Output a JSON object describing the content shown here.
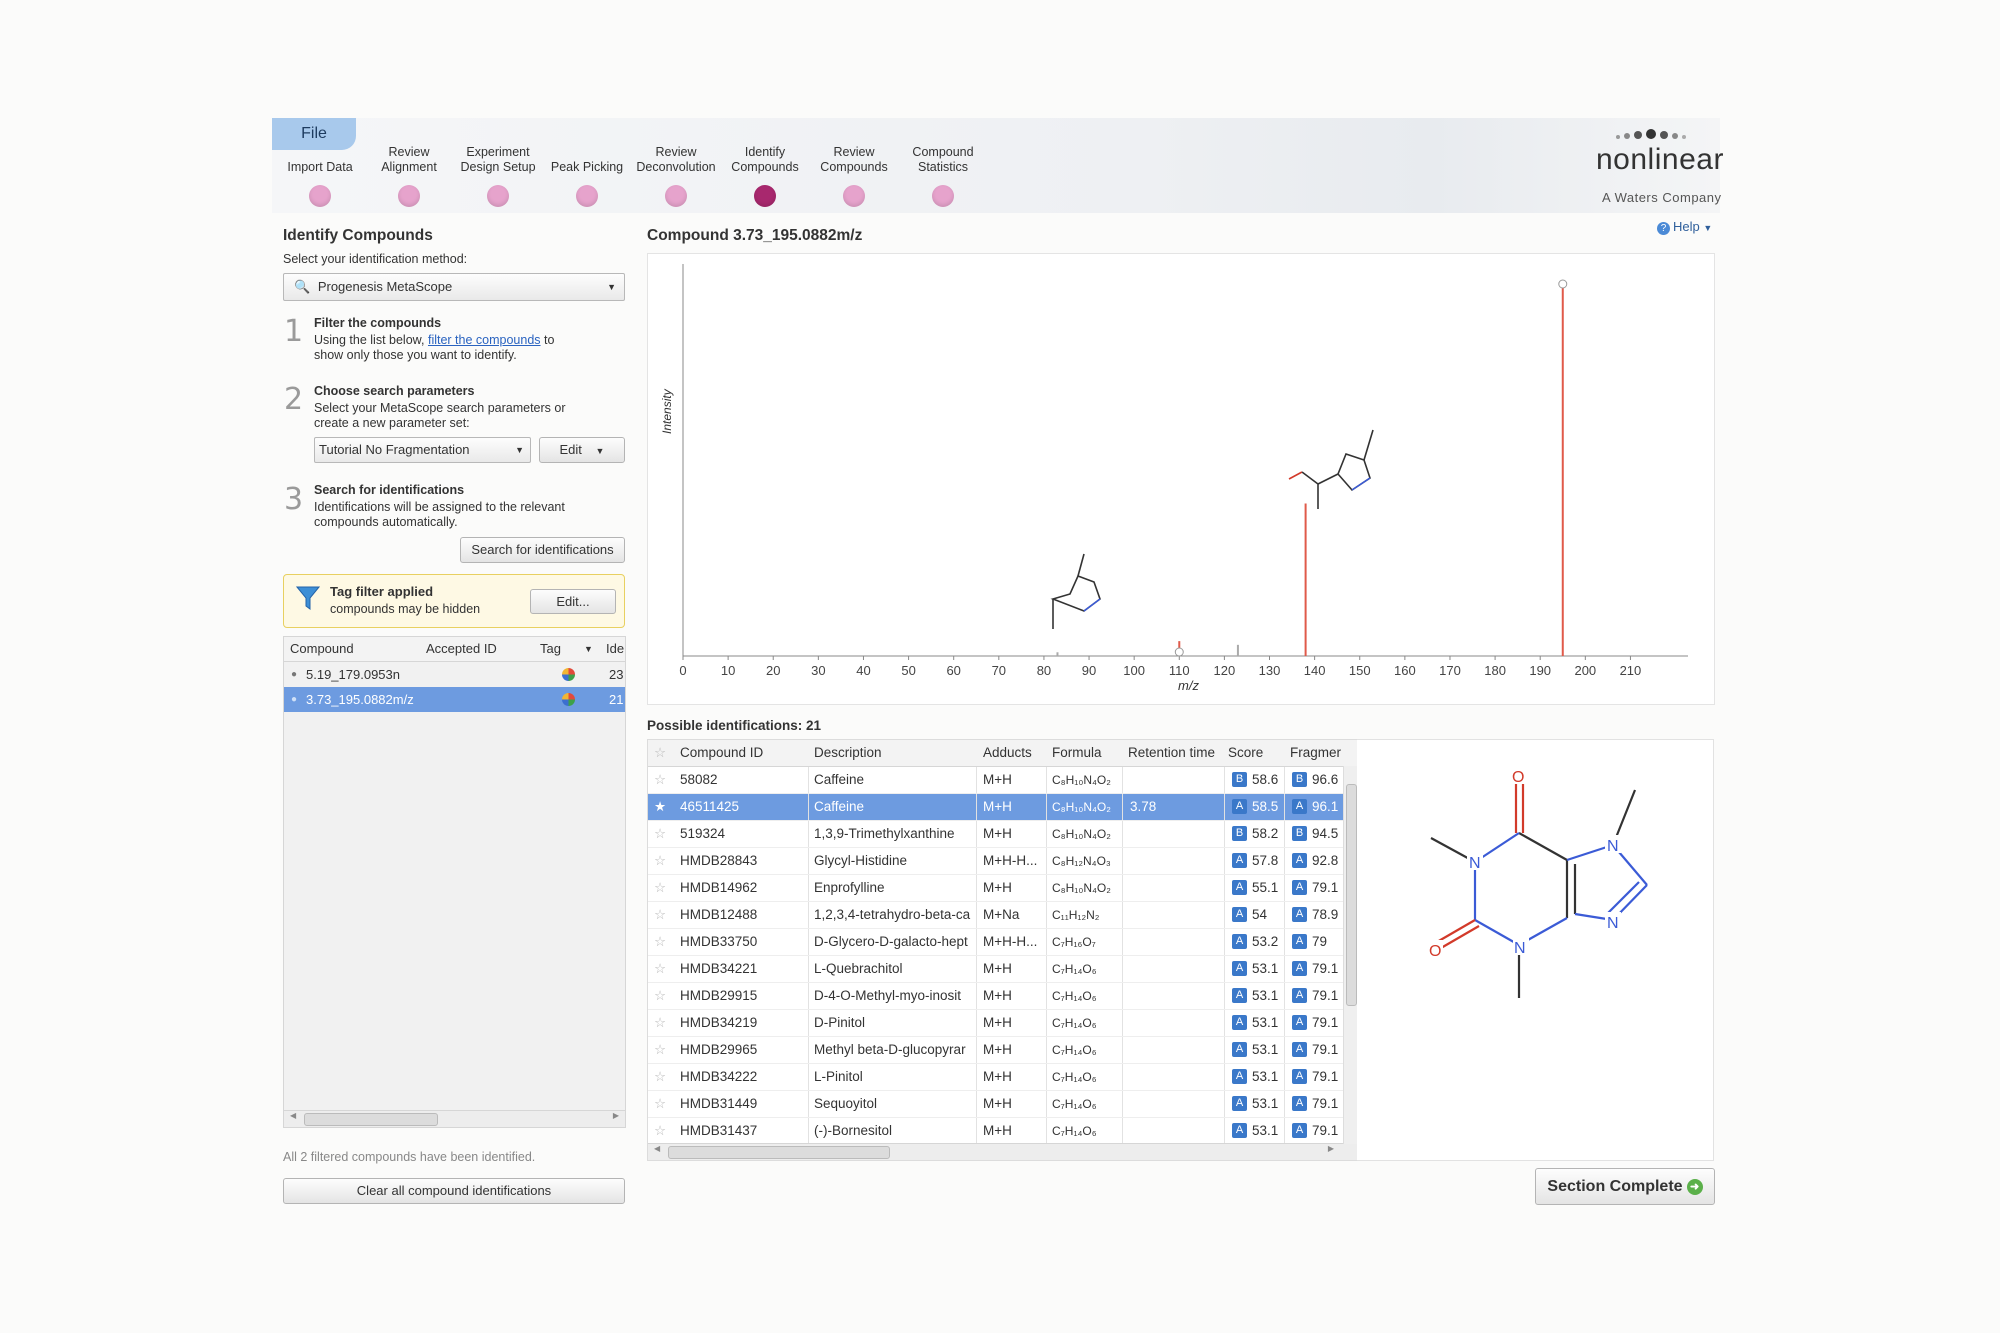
{
  "nav": {
    "file": "File",
    "steps": [
      {
        "l1": "",
        "l2": "Import Data"
      },
      {
        "l1": "Review",
        "l2": "Alignment"
      },
      {
        "l1": "Experiment",
        "l2": "Design Setup"
      },
      {
        "l1": "",
        "l2": "Peak Picking"
      },
      {
        "l1": "Review",
        "l2": "Deconvolution"
      },
      {
        "l1": "Identify",
        "l2": "Compounds"
      },
      {
        "l1": "Review",
        "l2": "Compounds"
      },
      {
        "l1": "Compound",
        "l2": "Statistics"
      }
    ],
    "active_step": 5
  },
  "brand": {
    "name": "nonlinear",
    "sub": "A Waters Company",
    "help": "Help"
  },
  "left": {
    "title": "Identify Compounds",
    "method_label": "Select your identification method:",
    "method_value": "Progenesis MetaScope",
    "step1": {
      "num": "1",
      "title": "Filter the compounds",
      "text_a": "Using the list below,",
      "link": "filter the compounds",
      "text_b": "to",
      "text_c": "show only those you want to identify."
    },
    "step2": {
      "num": "2",
      "title": "Choose search parameters",
      "text_a": "Select your MetaScope search parameters or",
      "text_b": "create a new parameter set:",
      "param_value": "Tutorial No Fragmentation",
      "edit": "Edit"
    },
    "step3": {
      "num": "3",
      "title": "Search for identifications",
      "text_a": "Identifications will be assigned to the relevant",
      "text_b": "compounds automatically.",
      "button": "Search for identifications"
    },
    "tag_filter": {
      "title": "Tag filter applied",
      "sub": "compounds may be hidden",
      "edit": "Edit..."
    },
    "table": {
      "headers": [
        "Compound",
        "Accepted ID",
        "Tag",
        "Ide"
      ],
      "rows": [
        {
          "compound": "5.19_179.0953n",
          "ide": "23"
        },
        {
          "compound": "3.73_195.0882m/z",
          "ide": "21"
        }
      ],
      "selected": 1
    },
    "status": "All 2 filtered compounds have been identified.",
    "clear_button": "Clear all compound identifications"
  },
  "chart_title": "Compound 3.73_195.0882m/z",
  "chart_data": {
    "type": "bar",
    "xlabel": "m/z",
    "ylabel": "Intensity",
    "xlim": [
      0,
      215
    ],
    "x_ticks": [
      0,
      10,
      20,
      30,
      40,
      50,
      60,
      70,
      80,
      90,
      100,
      110,
      120,
      130,
      140,
      150,
      160,
      170,
      180,
      190,
      200,
      210
    ],
    "ylim": [
      0,
      100
    ],
    "series": [
      {
        "color": "#e05a4a",
        "bars": [
          {
            "x": 110,
            "y": 4
          },
          {
            "x": 138,
            "y": 41
          },
          {
            "x": 195,
            "y": 100
          }
        ]
      },
      {
        "color": "#aaaaaa",
        "bars": [
          {
            "x": 83,
            "y": 1
          },
          {
            "x": 123,
            "y": 3
          }
        ]
      }
    ]
  },
  "idents": {
    "title": "Possible identifications: 21",
    "headers": [
      "Compound ID",
      "Description",
      "Adducts",
      "Formula",
      "Retention time",
      "Score",
      "Fragmer"
    ],
    "rows": [
      {
        "id": "58082",
        "desc": "Caffeine",
        "add": "M+H",
        "formula": "C₈H₁₀N₄O₂",
        "rt": "",
        "sb": "B",
        "score": "58.6",
        "fb": "B",
        "frag": "96.6"
      },
      {
        "id": "46511425",
        "desc": "Caffeine",
        "add": "M+H",
        "formula": "C₈H₁₀N₄O₂",
        "rt": "3.78",
        "sb": "A",
        "score": "58.5",
        "fb": "A",
        "frag": "96.1"
      },
      {
        "id": "519324",
        "desc": "1,3,9-Trimethylxanthine",
        "add": "M+H",
        "formula": "C₈H₁₀N₄O₂",
        "rt": "",
        "sb": "B",
        "score": "58.2",
        "fb": "B",
        "frag": "94.5"
      },
      {
        "id": "HMDB28843",
        "desc": "Glycyl-Histidine",
        "add": "M+H-H...",
        "formula": "C₈H₁₂N₄O₃",
        "rt": "",
        "sb": "A",
        "score": "57.8",
        "fb": "A",
        "frag": "92.8"
      },
      {
        "id": "HMDB14962",
        "desc": "Enprofylline",
        "add": "M+H",
        "formula": "C₈H₁₀N₄O₂",
        "rt": "",
        "sb": "A",
        "score": "55.1",
        "fb": "A",
        "frag": "79.1"
      },
      {
        "id": "HMDB12488",
        "desc": "1,2,3,4-tetrahydro-beta-ca",
        "add": "M+Na",
        "formula": "C₁₁H₁₂N₂",
        "rt": "",
        "sb": "A",
        "score": "54",
        "fb": "A",
        "frag": "78.9"
      },
      {
        "id": "HMDB33750",
        "desc": "D-Glycero-D-galacto-hept",
        "add": "M+H-H...",
        "formula": "C₇H₁₆O₇",
        "rt": "",
        "sb": "A",
        "score": "53.2",
        "fb": "A",
        "frag": "79"
      },
      {
        "id": "HMDB34221",
        "desc": "L-Quebrachitol",
        "add": "M+H",
        "formula": "C₇H₁₄O₆",
        "rt": "",
        "sb": "A",
        "score": "53.1",
        "fb": "A",
        "frag": "79.1"
      },
      {
        "id": "HMDB29915",
        "desc": "D-4-O-Methyl-myo-inosit",
        "add": "M+H",
        "formula": "C₇H₁₄O₆",
        "rt": "",
        "sb": "A",
        "score": "53.1",
        "fb": "A",
        "frag": "79.1"
      },
      {
        "id": "HMDB34219",
        "desc": "D-Pinitol",
        "add": "M+H",
        "formula": "C₇H₁₄O₆",
        "rt": "",
        "sb": "A",
        "score": "53.1",
        "fb": "A",
        "frag": "79.1"
      },
      {
        "id": "HMDB29965",
        "desc": "Methyl beta-D-glucopyrar",
        "add": "M+H",
        "formula": "C₇H₁₄O₆",
        "rt": "",
        "sb": "A",
        "score": "53.1",
        "fb": "A",
        "frag": "79.1"
      },
      {
        "id": "HMDB34222",
        "desc": "L-Pinitol",
        "add": "M+H",
        "formula": "C₇H₁₄O₆",
        "rt": "",
        "sb": "A",
        "score": "53.1",
        "fb": "A",
        "frag": "79.1"
      },
      {
        "id": "HMDB31449",
        "desc": "Sequoyitol",
        "add": "M+H",
        "formula": "C₇H₁₄O₆",
        "rt": "",
        "sb": "A",
        "score": "53.1",
        "fb": "A",
        "frag": "79.1"
      },
      {
        "id": "HMDB31437",
        "desc": "(-)-Bornesitol",
        "add": "M+H",
        "formula": "C₇H₁₄O₆",
        "rt": "",
        "sb": "A",
        "score": "53.1",
        "fb": "A",
        "frag": "79.1"
      }
    ],
    "selected": 1
  },
  "molecule": {
    "atoms": [
      "O",
      "N",
      "N",
      "N",
      "N",
      "O"
    ]
  },
  "section_complete": "Section Complete",
  "colors": {
    "accent": "#6d9be0",
    "active_step": "#a8286e",
    "step": "#e6a3cc",
    "peak": "#e05a4a",
    "badge": "#3a78c9"
  }
}
